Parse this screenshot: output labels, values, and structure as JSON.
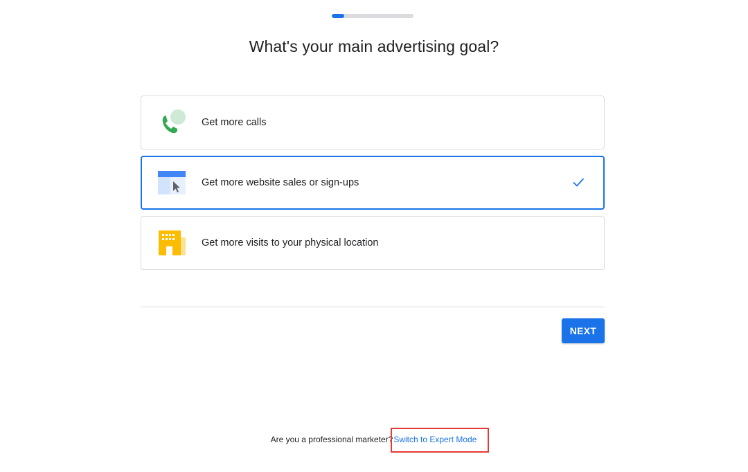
{
  "progress": {
    "value": 0.15
  },
  "title": "What's your main advertising goal?",
  "options": [
    {
      "label": "Get more calls",
      "icon": "phone-call-icon",
      "selected": false
    },
    {
      "label": "Get more website sales or sign-ups",
      "icon": "website-cursor-icon",
      "selected": true
    },
    {
      "label": "Get more visits to your physical location",
      "icon": "building-storefront-icon",
      "selected": false
    }
  ],
  "next_label": "NEXT",
  "footer": {
    "prefix": "Are you a professional marketer?",
    "link_label": "Switch to Expert Mode"
  },
  "colors": {
    "accent": "#1a73e8",
    "border": "#dadce0",
    "highlight": "#e53935"
  }
}
